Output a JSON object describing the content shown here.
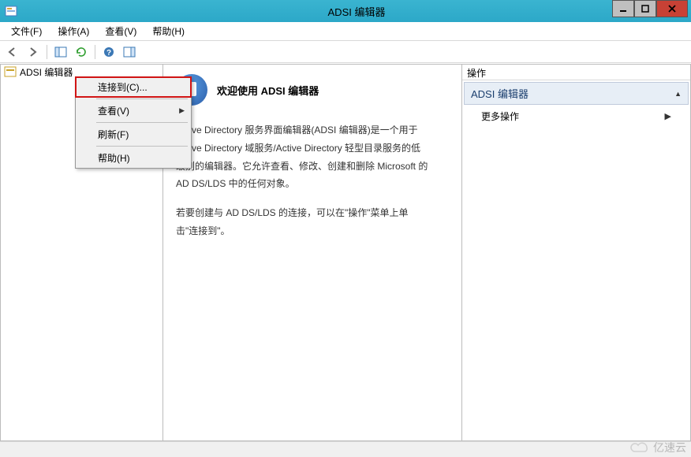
{
  "window": {
    "title": "ADSI 编辑器"
  },
  "menubar": {
    "file": "文件(F)",
    "action": "操作(A)",
    "view": "查看(V)",
    "help": "帮助(H)"
  },
  "tree": {
    "root": "ADSI 编辑器"
  },
  "context_menu": {
    "connect": "连接到(C)...",
    "view": "查看(V)",
    "refresh": "刷新(F)",
    "help": "帮助(H)"
  },
  "welcome": {
    "title": "欢迎使用 ADSI 编辑器",
    "para1": "Active Directory 服务界面编辑器(ADSI 编辑器)是一个用于 Active Directory 域服务/Active Directory 轻型目录服务的低级别的编辑器。它允许查看、修改、创建和删除 Microsoft 的 AD DS/LDS 中的任何对象。",
    "para2": "若要创建与 AD DS/LDS 的连接，可以在\"操作\"菜单上单击\"连接到\"。"
  },
  "actions": {
    "header": "操作",
    "section": "ADSI 编辑器",
    "more": "更多操作"
  },
  "watermark": "亿速云"
}
